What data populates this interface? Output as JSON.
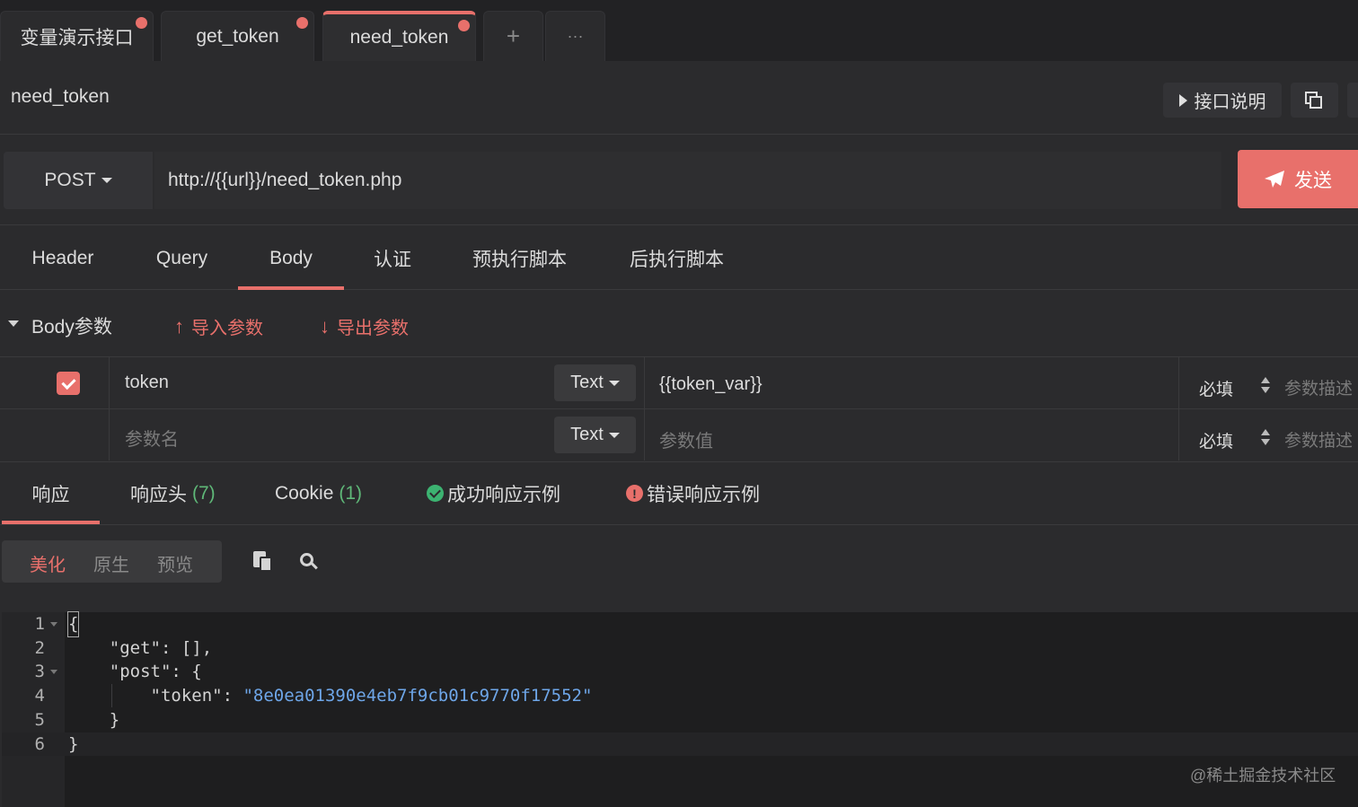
{
  "tabs": [
    {
      "label": "变量演示接口",
      "modified": true
    },
    {
      "label": "get_token",
      "modified": true
    },
    {
      "label": "need_token",
      "modified": true,
      "active": true
    }
  ],
  "tab_add_label": "+",
  "tab_more_label": "···",
  "header": {
    "title": "need_token",
    "doc_button": "接口说明"
  },
  "request": {
    "method": "POST",
    "url": "http://{{url}}/need_token.php",
    "send_label": "发送"
  },
  "request_tabs": [
    "Header",
    "Query",
    "Body",
    "认证",
    "预执行脚本",
    "后执行脚本"
  ],
  "active_request_tab": "Body",
  "body_params": {
    "title": "Body参数",
    "import_label": "导入参数",
    "export_label": "导出参数",
    "rows": [
      {
        "checked": true,
        "name": "token",
        "type": "Text",
        "value": "{{token_var}}",
        "required": "必填",
        "desc_placeholder": "参数描述"
      },
      {
        "checked": false,
        "name_placeholder": "参数名",
        "type": "Text",
        "value_placeholder": "参数值",
        "required": "必填",
        "desc_placeholder": "参数描述"
      }
    ]
  },
  "response_tabs": {
    "response": "响应",
    "headers": "响应头",
    "headers_count": "(7)",
    "cookie": "Cookie",
    "cookie_count": "(1)",
    "success_example": "成功响应示例",
    "error_example": "错误响应示例"
  },
  "view_modes": [
    "美化",
    "原生",
    "预览"
  ],
  "active_view_mode": "美化",
  "code_lines": [
    {
      "n": "1",
      "text": "{"
    },
    {
      "n": "2",
      "text": "    \"get\": [],"
    },
    {
      "n": "3",
      "text": "    \"post\": {"
    },
    {
      "n": "4",
      "key": "        \"token\": ",
      "value": "\"8e0ea01390e4eb7f9cb01c9770f17552\""
    },
    {
      "n": "5",
      "text": "    }"
    },
    {
      "n": "6",
      "text": "}"
    }
  ],
  "watermark": "@稀土掘金技术社区",
  "colors": {
    "accent": "#e8706b",
    "success": "#3cb371",
    "string": "#6ea6e8"
  }
}
